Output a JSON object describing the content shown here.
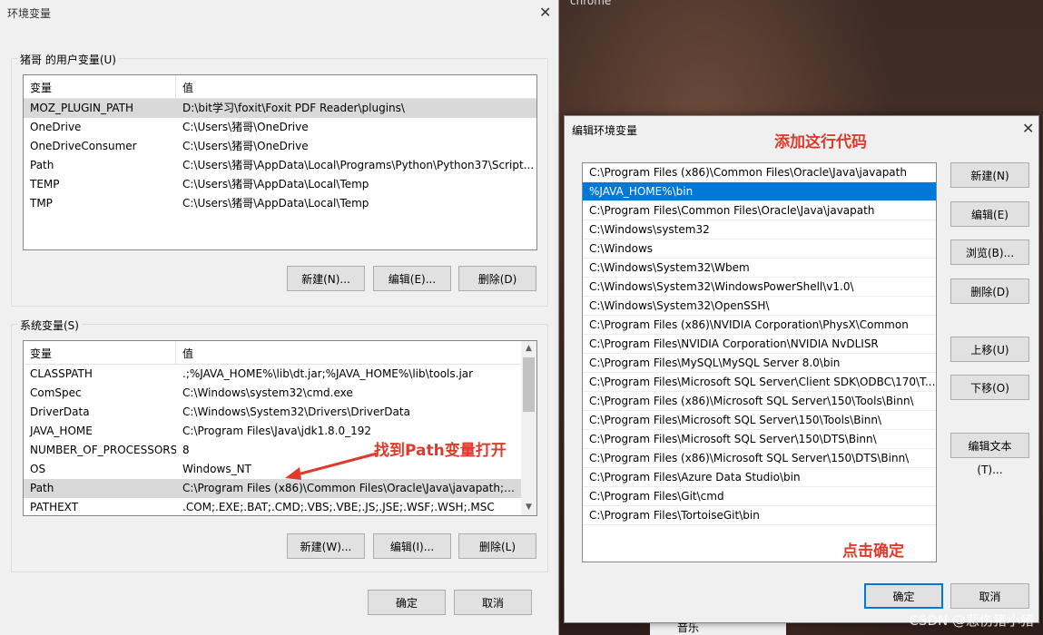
{
  "background": {
    "app_label": "chrome",
    "music_label": "音乐",
    "watermark": "CSDN @悲伤猪小猪"
  },
  "env_dialog": {
    "title": "环境变量",
    "user_group": {
      "legend": "猪哥 的用户变量(U)",
      "headers": {
        "var": "变量",
        "val": "值"
      },
      "rows": [
        {
          "var": "MOZ_PLUGIN_PATH",
          "val": "D:\\bit学习\\foxit\\Foxit PDF Reader\\plugins\\"
        },
        {
          "var": "OneDrive",
          "val": "C:\\Users\\猪哥\\OneDrive"
        },
        {
          "var": "OneDriveConsumer",
          "val": "C:\\Users\\猪哥\\OneDrive"
        },
        {
          "var": "Path",
          "val": "C:\\Users\\猪哥\\AppData\\Local\\Programs\\Python\\Python37\\Script..."
        },
        {
          "var": "TEMP",
          "val": "C:\\Users\\猪哥\\AppData\\Local\\Temp"
        },
        {
          "var": "TMP",
          "val": "C:\\Users\\猪哥\\AppData\\Local\\Temp"
        }
      ],
      "buttons": {
        "new": "新建(N)...",
        "edit": "编辑(E)...",
        "delete": "删除(D)"
      }
    },
    "system_group": {
      "legend": "系统变量(S)",
      "headers": {
        "var": "变量",
        "val": "值"
      },
      "rows": [
        {
          "var": "CLASSPATH",
          "val": ".;%JAVA_HOME%\\lib\\dt.jar;%JAVA_HOME%\\lib\\tools.jar"
        },
        {
          "var": "ComSpec",
          "val": "C:\\Windows\\system32\\cmd.exe"
        },
        {
          "var": "DriverData",
          "val": "C:\\Windows\\System32\\Drivers\\DriverData"
        },
        {
          "var": "JAVA_HOME",
          "val": "C:\\Program Files\\Java\\jdk1.8.0_192"
        },
        {
          "var": "NUMBER_OF_PROCESSORS",
          "val": "8"
        },
        {
          "var": "OS",
          "val": "Windows_NT"
        },
        {
          "var": "Path",
          "val": "C:\\Program Files (x86)\\Common Files\\Oracle\\Java\\javapath;%..."
        },
        {
          "var": "PATHEXT",
          "val": ".COM;.EXE;.BAT;.CMD;.VBS;.VBE;.JS;.JSE;.WSF;.WSH;.MSC"
        }
      ],
      "buttons": {
        "new": "新建(W)...",
        "edit": "编辑(I)...",
        "delete": "删除(L)"
      }
    },
    "ok": "确定",
    "cancel": "取消",
    "annotation": "找到Path变量打开"
  },
  "edit_dialog": {
    "title": "编辑环境变量",
    "annotation_top": "添加这行代码",
    "annotation_bottom": "点击确定",
    "items": [
      "C:\\Program Files (x86)\\Common Files\\Oracle\\Java\\javapath",
      "%JAVA_HOME%\\bin",
      "C:\\Program Files\\Common Files\\Oracle\\Java\\javapath",
      "C:\\Windows\\system32",
      "C:\\Windows",
      "C:\\Windows\\System32\\Wbem",
      "C:\\Windows\\System32\\WindowsPowerShell\\v1.0\\",
      "C:\\Windows\\System32\\OpenSSH\\",
      "C:\\Program Files (x86)\\NVIDIA Corporation\\PhysX\\Common",
      "C:\\Program Files\\NVIDIA Corporation\\NVIDIA NvDLISR",
      "C:\\Program Files\\MySQL\\MySQL Server 8.0\\bin",
      "C:\\Program Files\\Microsoft SQL Server\\Client SDK\\ODBC\\170\\T...",
      "C:\\Program Files (x86)\\Microsoft SQL Server\\150\\Tools\\Binn\\",
      "C:\\Program Files\\Microsoft SQL Server\\150\\Tools\\Binn\\",
      "C:\\Program Files\\Microsoft SQL Server\\150\\DTS\\Binn\\",
      "C:\\Program Files (x86)\\Microsoft SQL Server\\150\\DTS\\Binn\\",
      "C:\\Program Files\\Azure Data Studio\\bin",
      "C:\\Program Files\\Git\\cmd",
      "C:\\Program Files\\TortoiseGit\\bin"
    ],
    "buttons": {
      "new": "新建(N)",
      "edit": "编辑(E)",
      "browse": "浏览(B)...",
      "delete": "删除(D)",
      "up": "上移(U)",
      "down": "下移(O)",
      "edit_text": "编辑文本(T)...",
      "ok": "确定",
      "cancel": "取消"
    }
  }
}
